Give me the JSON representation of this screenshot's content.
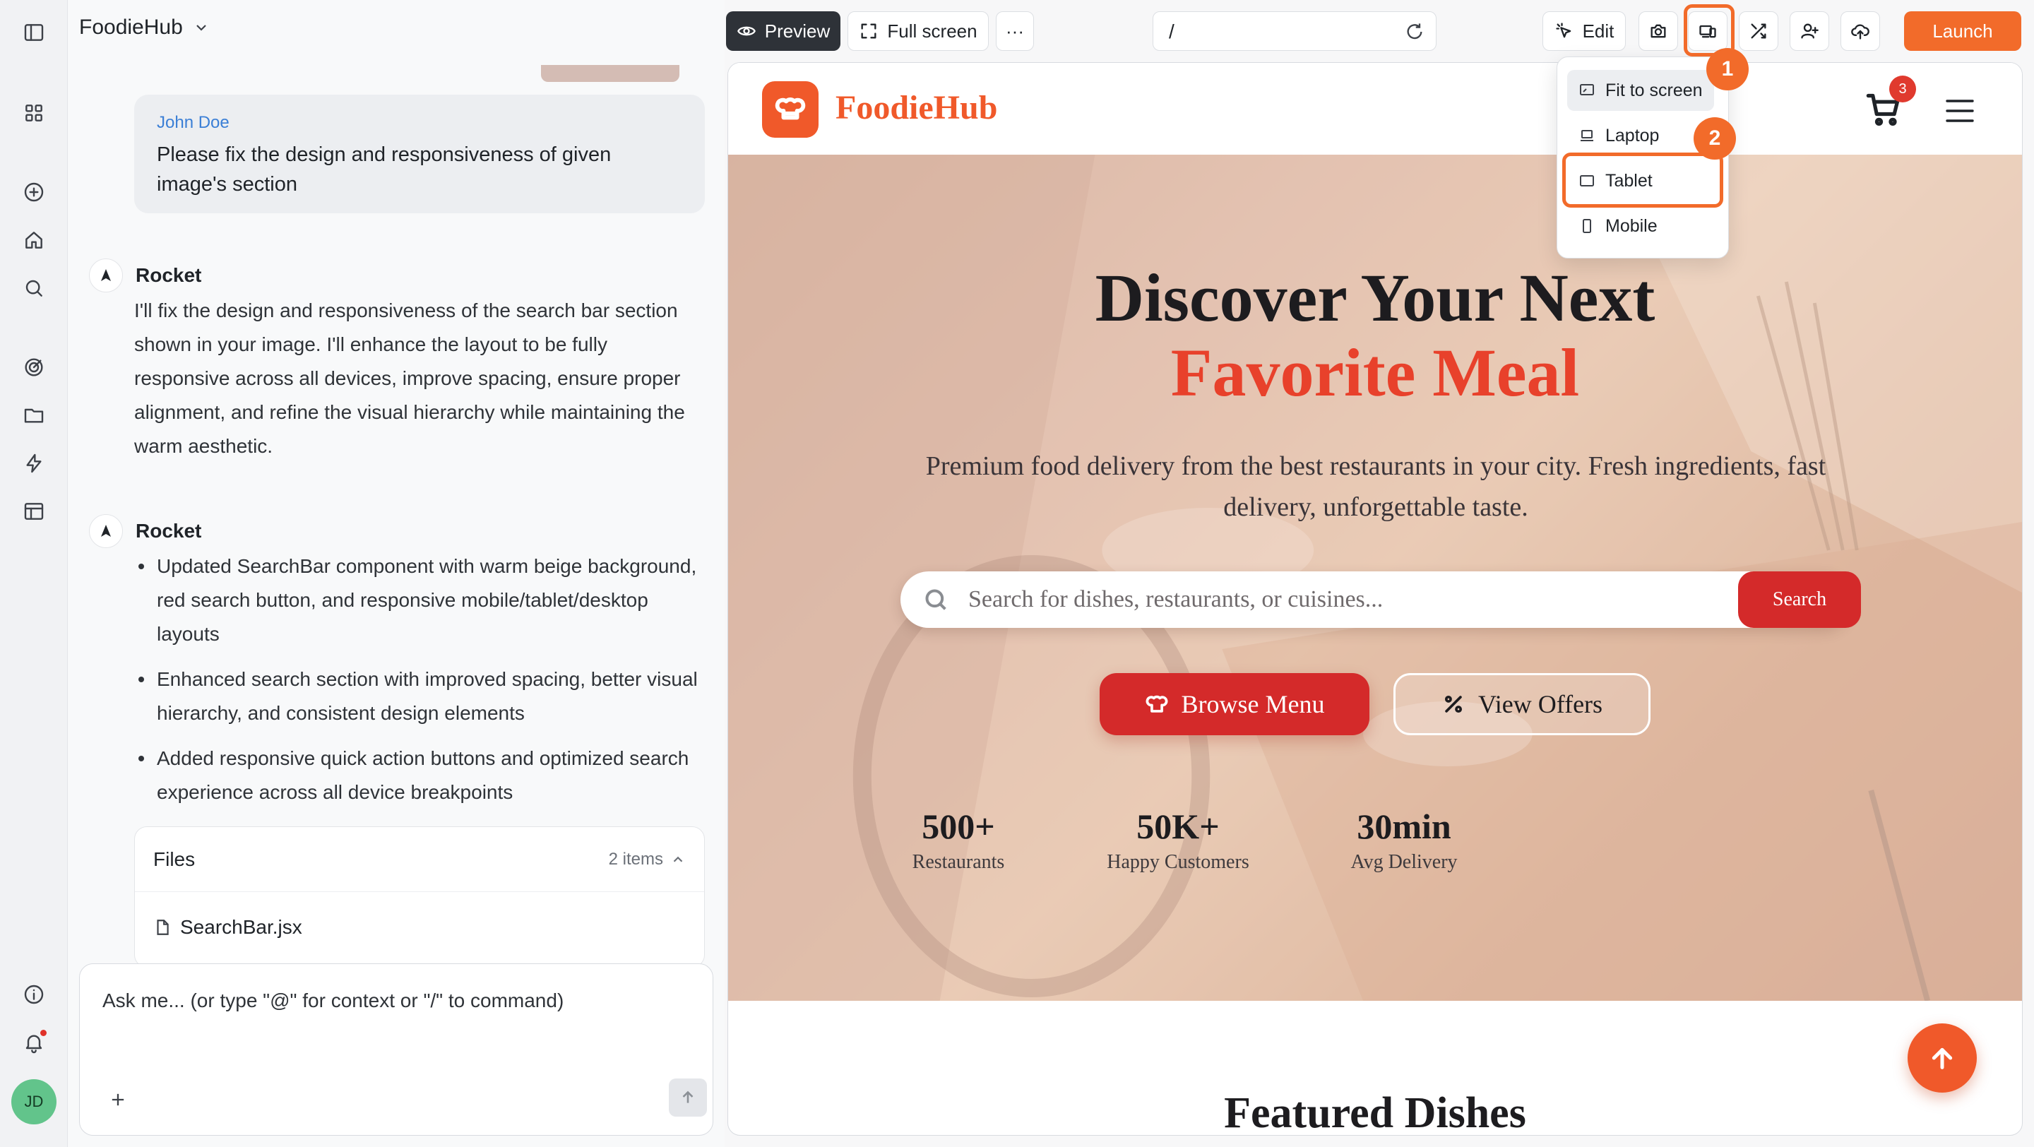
{
  "sidebar": {
    "icons": [
      "sidebar-toggle-icon",
      "grid-icon",
      "plus-circle-icon",
      "home-icon",
      "search-icon",
      "target-icon",
      "folder-icon",
      "lightning-icon",
      "layout-icon",
      "info-icon",
      "bell-icon"
    ],
    "avatar_initials": "JD"
  },
  "chat": {
    "project_name": "FoodieHub",
    "user_message": {
      "author": "John Doe",
      "text": "Please fix the design and responsiveness of given image's section"
    },
    "assistant_name": "Rocket",
    "assistant_reply_1": "I'll fix the design and responsiveness of the search bar section shown in your image. I'll enhance the layout to be fully responsive across all devices, improve spacing, ensure proper alignment, and refine the visual hierarchy while maintaining the warm aesthetic.",
    "assistant_bullets": [
      "Updated SearchBar component with warm beige background, red search button, and responsive mobile/tablet/desktop layouts",
      "Enhanced search section with improved spacing, better visual hierarchy, and consistent design elements",
      "Added responsive quick action buttons and optimized search experience across all device breakpoints"
    ],
    "files": {
      "title": "Files",
      "count": "2 items",
      "items": [
        "SearchBar.jsx"
      ]
    },
    "composer_placeholder": "Ask me... (or type \"@\" for context or \"/\" to command)"
  },
  "toolbar": {
    "preview_label": "Preview",
    "fullscreen_label": "Full screen",
    "more_label": "···",
    "url_value": "/",
    "edit_label": "Edit",
    "launch_label": "Launch",
    "accent_color": "#f26b2a"
  },
  "device_menu": {
    "items": [
      "Fit to screen",
      "Laptop",
      "Tablet",
      "Mobile"
    ],
    "selected": "Fit to screen",
    "highlighted": "Tablet"
  },
  "annotations": {
    "marker_1": "1",
    "marker_2": "2"
  },
  "site": {
    "brand": "FoodieHub",
    "brand_color": "#f0592a",
    "cart_count": "3",
    "hero_title": "Discover Your Next",
    "hero_accent": "Favorite Meal",
    "hero_subtitle": "Premium food delivery from the best restaurants in your city. Fresh ingredients, fast delivery, unforgettable taste.",
    "search_placeholder": "Search for dishes, restaurants, or cuisines...",
    "search_button": "Search",
    "browse_button": "Browse Menu",
    "offers_button": "View Offers",
    "stats": [
      {
        "value": "500+",
        "label": "Restaurants"
      },
      {
        "value": "50K+",
        "label": "Happy Customers"
      },
      {
        "value": "30min",
        "label": "Avg Delivery"
      }
    ],
    "featured_heading": "Featured Dishes"
  }
}
